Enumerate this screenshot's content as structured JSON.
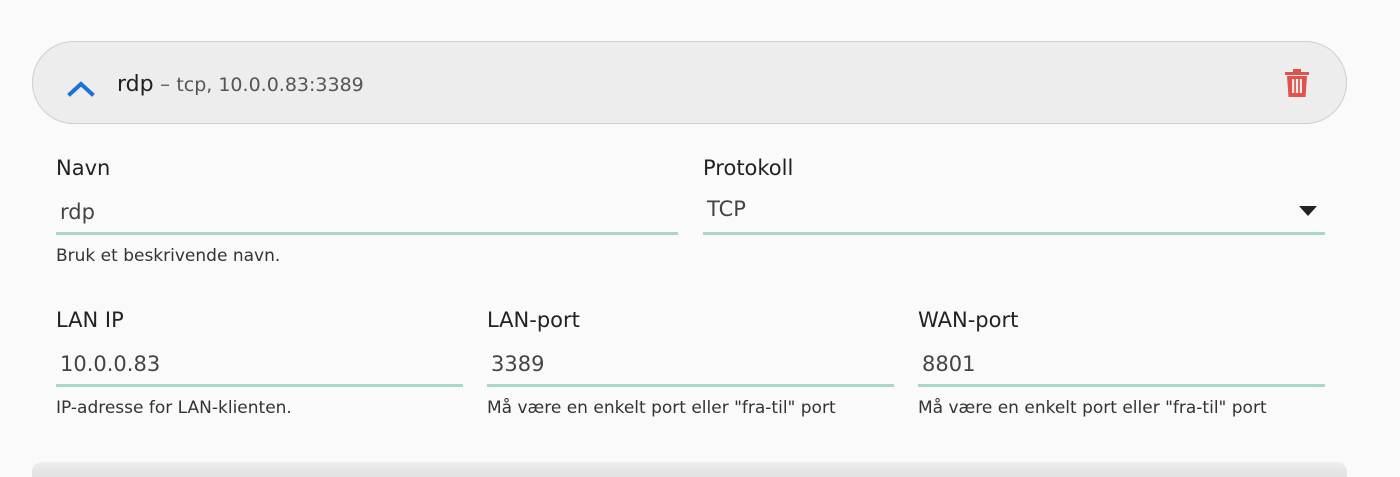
{
  "rule": {
    "name": "rdp",
    "separator": " – ",
    "summary": "tcp, 10.0.0.83:3389"
  },
  "fields": {
    "name": {
      "label": "Navn",
      "value": "rdp",
      "help": "Bruk et beskrivende navn."
    },
    "protocol": {
      "label": "Protokoll",
      "value": "TCP"
    },
    "lan_ip": {
      "label": "LAN IP",
      "value": "10.0.0.83",
      "help": "IP-adresse for LAN-klienten."
    },
    "lan_port": {
      "label": "LAN-port",
      "value": "3389",
      "help": "Må være en enkelt port eller \"fra-til\" port"
    },
    "wan_port": {
      "label": "WAN-port",
      "value": "8801",
      "help": "Må være en enkelt port eller \"fra-til\" port"
    }
  },
  "icons": {
    "collapse": "chevron-up-icon",
    "delete": "trash-icon"
  },
  "colors": {
    "accent_blue": "#1a73d9",
    "delete_red": "#e0524a",
    "input_underline": "#a8d8cc",
    "header_bg": "#ededed"
  }
}
